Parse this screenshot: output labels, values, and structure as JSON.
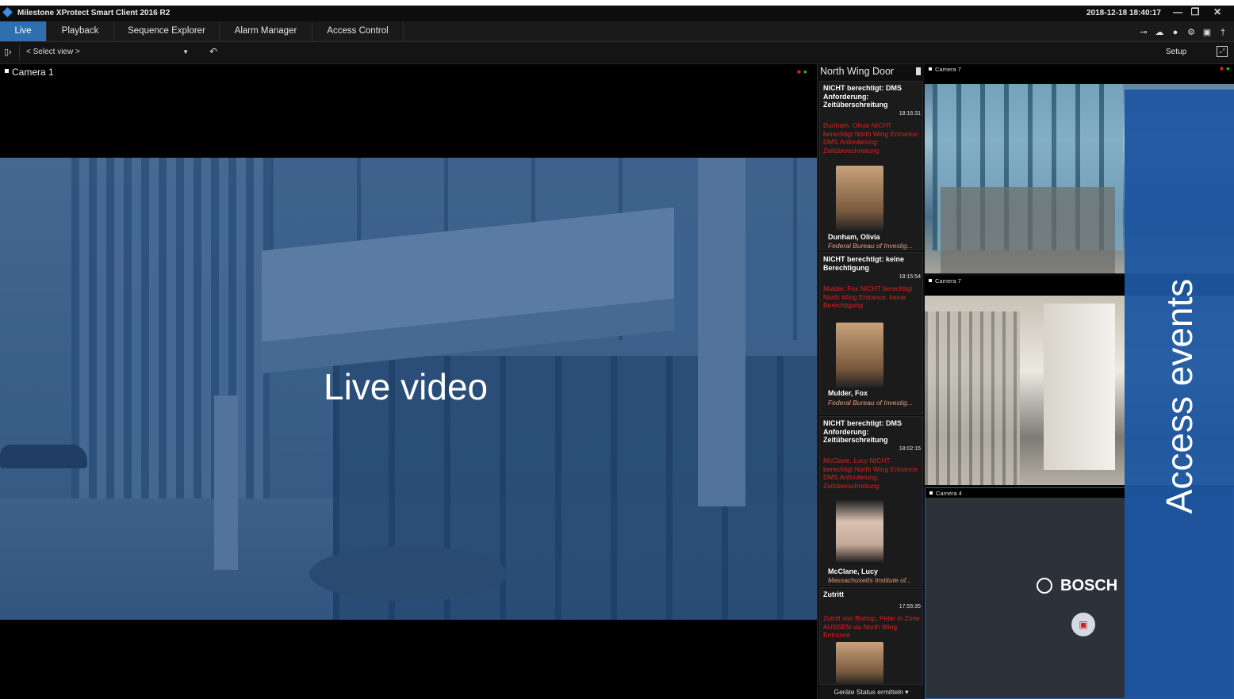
{
  "window": {
    "title": "Milestone XProtect Smart Client 2016 R2",
    "datetime": "2018-12-18 18:40:17",
    "controls": [
      "minimize-icon",
      "restore-icon",
      "close-icon"
    ]
  },
  "tabs": [
    {
      "label": "Live",
      "active": true
    },
    {
      "label": "Playback",
      "active": false
    },
    {
      "label": "Sequence Explorer",
      "active": false
    },
    {
      "label": "Alarm Manager",
      "active": false
    },
    {
      "label": "Access Control",
      "active": false
    }
  ],
  "toolbar_icons": [
    "plug-icon",
    "cloud-icon",
    "help-icon",
    "gear-icon",
    "windows-icon",
    "pin-icon"
  ],
  "viewbar": {
    "select_view": "< Select view >",
    "setup": "Setup"
  },
  "main_camera": {
    "label": "Camera 1",
    "overlay_text": "Live video"
  },
  "access_panel": {
    "door": "North Wing Door",
    "footer": "Geräte Status ermitteln",
    "events": [
      {
        "title": "NICHT berechtigt: DMS Anforderung: Zeitüberschreitung",
        "time": "18:16:31",
        "desc": "Dunham, Olivia NICHT berechtigt North Wing Entrance: DMS Anforderung: Zeitüberschreitung",
        "name": "Dunham, Olivia",
        "org": "Federal Bureau of Investig..."
      },
      {
        "title": "NICHT berechtigt: keine Berechtigung",
        "time": "18:15:54",
        "desc": "Mulder, Fox NICHT berechtigt North Wing Entrance: keine Berechtigung",
        "name": "Mulder, Fox",
        "org": "Federal Bureau of Investig..."
      },
      {
        "title": "NICHT berechtigt: DMS Anforderung: Zeitüberschreitung",
        "time": "18:02:15",
        "desc": "McClane, Lucy NICHT berechtigt North Wing Entrance: DMS Anforderung: Zeitüberschreitung",
        "name": "McClane, Lucy",
        "org": "Massachusetts Institute of..."
      },
      {
        "title": "Zutritt",
        "time": "17:55:35",
        "desc": "Zutritt von Bishop, Peter in Zone AUSSEN via North Wing Entrance",
        "name": "",
        "org": ""
      }
    ]
  },
  "side_cameras": [
    {
      "label": "Camera 7"
    },
    {
      "label": "Camera 7"
    },
    {
      "label": "Camera 4"
    }
  ],
  "bosch_logo": "BOSCH",
  "access_overlay_text": "Access events"
}
